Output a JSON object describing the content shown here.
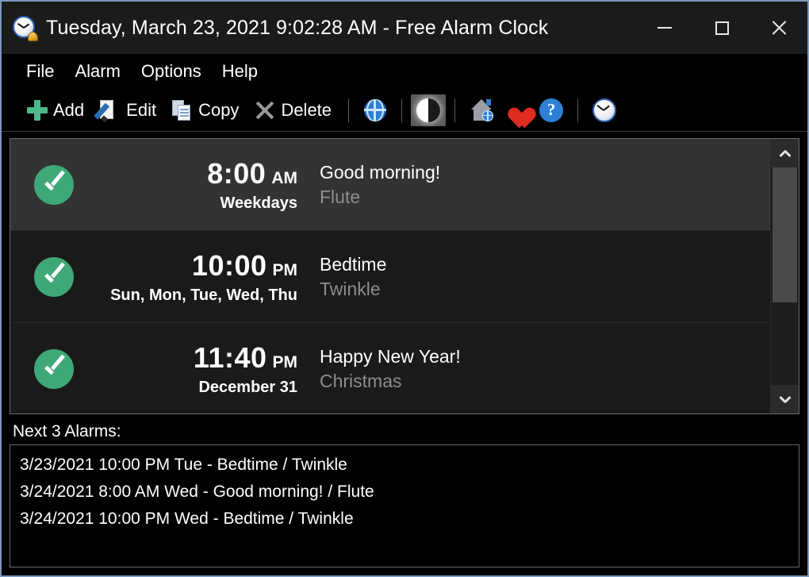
{
  "window": {
    "title": "Tuesday, March 23, 2021 9:02:28 AM - Free Alarm Clock",
    "app_icon": "alarm-clock-icon",
    "border_color": "#7a97b8",
    "titlebar_bg": "#1b1b1b",
    "controls": {
      "minimize": "minimize-icon",
      "maximize": "maximize-icon",
      "close": "close-icon"
    }
  },
  "menubar": {
    "items": [
      {
        "label": "File"
      },
      {
        "label": "Alarm"
      },
      {
        "label": "Options"
      },
      {
        "label": "Help"
      }
    ]
  },
  "toolbar": {
    "buttons": [
      {
        "label": "Add",
        "icon": "plus-icon",
        "accent": "#4cb98a"
      },
      {
        "label": "Edit",
        "icon": "pencil-page-icon"
      },
      {
        "label": "Copy",
        "icon": "copy-pages-icon"
      },
      {
        "label": "Delete",
        "icon": "x-icon"
      }
    ],
    "icon_buttons": [
      {
        "icon": "globe-icon",
        "name": "language-button",
        "active": false
      },
      {
        "icon": "contrast-icon",
        "name": "theme-contrast-button",
        "active": true
      },
      {
        "icon": "home-globe-icon",
        "name": "website-button",
        "active": false
      },
      {
        "icon": "heart-icon",
        "name": "donate-button",
        "active": false
      },
      {
        "icon": "question-mark-icon",
        "name": "help-button",
        "active": false
      },
      {
        "icon": "clock-icon",
        "name": "time-sync-button",
        "active": false
      }
    ]
  },
  "alarm_list": {
    "rows": [
      {
        "enabled": true,
        "enabled_icon": "check-circle-icon",
        "time": "8:00",
        "ampm": "AM",
        "days": "Weekdays",
        "title": "Good morning!",
        "sound": "Flute",
        "selected": true
      },
      {
        "enabled": true,
        "enabled_icon": "check-circle-icon",
        "time": "10:00",
        "ampm": "PM",
        "days": "Sun, Mon, Tue, Wed, Thu",
        "title": "Bedtime",
        "sound": "Twinkle",
        "selected": false
      },
      {
        "enabled": true,
        "enabled_icon": "check-circle-icon",
        "time": "11:40",
        "ampm": "PM",
        "days": "December 31",
        "title": "Happy New Year!",
        "sound": "Christmas",
        "selected": false
      }
    ],
    "scrollbar": {
      "up_icon": "chevron-up-icon",
      "down_icon": "chevron-down-icon",
      "thumb_position_percent": 0,
      "thumb_size_percent": 62
    }
  },
  "next_alarms": {
    "label": "Next 3 Alarms:",
    "lines": [
      "3/23/2021 10:00 PM Tue - Bedtime / Twinkle",
      "3/24/2021 8:00 AM Wed - Good morning! / Flute",
      "3/24/2021 10:00 PM Wed - Bedtime / Twinkle"
    ]
  },
  "colors": {
    "accent_green": "#3fa877",
    "accent_blue": "#2f7fd6",
    "accent_red": "#e02b20",
    "row_selected_bg": "#333333",
    "row_bg": "#1a1a1a",
    "text_primary": "#ffffff",
    "text_secondary": "#8e8e8e"
  }
}
